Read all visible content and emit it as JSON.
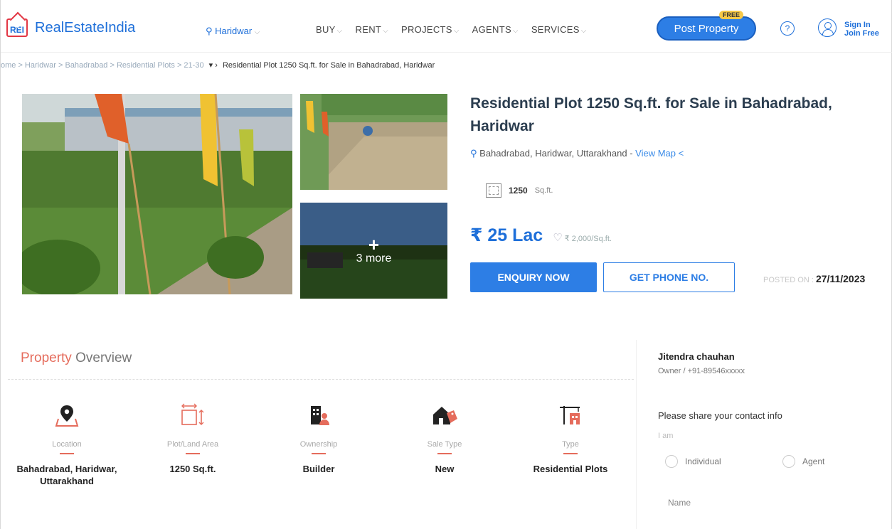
{
  "header": {
    "logo_mark": "REI",
    "logo_text": "RealEstateIndia",
    "city": "Haridwar",
    "nav": [
      "BUY",
      "RENT",
      "PROJECTS",
      "AGENTS",
      "SERVICES"
    ],
    "post_property": "Post Property",
    "free_badge": "FREE",
    "sign_in": "Sign In",
    "join_free": "Join Free"
  },
  "breadcrumb": {
    "trail": "ome > Haridwar > Bahadrabad > Residential Plots > 21-30",
    "current": "Residential Plot 1250 Sq.ft. for Sale in Bahadrabad, Haridwar"
  },
  "gallery": {
    "more_label": "3 more"
  },
  "property": {
    "title": "Residential Plot 1250 Sq.ft. for Sale in Bahadrabad, Haridwar",
    "location": "Bahadrabad, Haridwar, Uttarakhand",
    "view_map": "View Map",
    "area_value": "1250",
    "area_unit": "Sq.ft.",
    "price": "₹ 25 Lac",
    "rate": "₹ 2,000/Sq.ft.",
    "enquiry_btn": "ENQUIRY NOW",
    "phone_btn": "GET PHONE NO.",
    "posted_label": "POSTED ON :",
    "posted_date": "27/11/2023"
  },
  "overview": {
    "title_a": "Property",
    "title_b": "Overview",
    "items": [
      {
        "label": "Location",
        "value": "Bahadrabad, Haridwar, Uttarakhand",
        "icon": "location-pin-icon"
      },
      {
        "label": "Plot/Land Area",
        "value": "1250 Sq.ft.",
        "icon": "area-icon"
      },
      {
        "label": "Ownership",
        "value": "Builder",
        "icon": "building-owner-icon"
      },
      {
        "label": "Sale Type",
        "value": "New",
        "icon": "house-tag-icon"
      },
      {
        "label": "Type",
        "value": "Residential Plots",
        "icon": "plot-type-icon"
      }
    ]
  },
  "contact": {
    "owner_name": "Jitendra chauhan",
    "owner_sub": "Owner / +91-89546xxxxx",
    "share_prompt": "Please share your contact info",
    "i_am": "I am",
    "option_individual": "Individual",
    "option_agent": "Agent",
    "name_label": "Name"
  },
  "colors": {
    "brand_blue": "#2d7ee5",
    "accent_red": "#e56c5c"
  }
}
